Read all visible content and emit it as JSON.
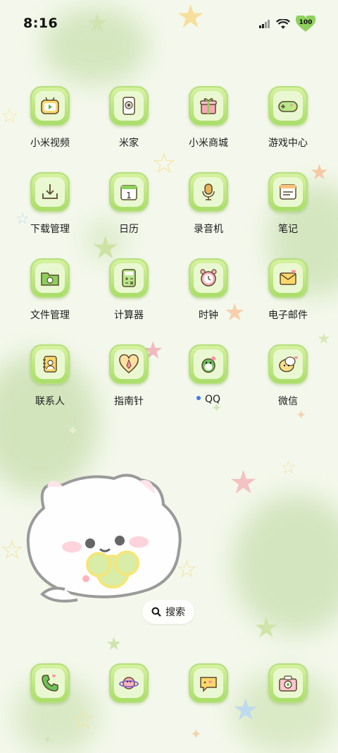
{
  "status_bar": {
    "time": "8:16",
    "battery_level": "100"
  },
  "apps": [
    {
      "label": "小米视频",
      "icon": "tv-icon"
    },
    {
      "label": "米家",
      "icon": "home-device-icon"
    },
    {
      "label": "小米商城",
      "icon": "gift-icon"
    },
    {
      "label": "游戏中心",
      "icon": "gamepad-icon"
    },
    {
      "label": "下载管理",
      "icon": "download-icon"
    },
    {
      "label": "日历",
      "icon": "calendar-icon",
      "calendar_day": "1"
    },
    {
      "label": "录音机",
      "icon": "microphone-icon"
    },
    {
      "label": "笔记",
      "icon": "notes-icon"
    },
    {
      "label": "文件管理",
      "icon": "folder-icon"
    },
    {
      "label": "计算器",
      "icon": "calculator-icon"
    },
    {
      "label": "时钟",
      "icon": "alarm-clock-icon"
    },
    {
      "label": "电子邮件",
      "icon": "envelope-icon"
    },
    {
      "label": "联系人",
      "icon": "contacts-icon"
    },
    {
      "label": "指南针",
      "icon": "compass-icon"
    },
    {
      "label": "QQ",
      "icon": "qq-icon",
      "new_install_dot": true
    },
    {
      "label": "微信",
      "icon": "wechat-icon"
    }
  ],
  "search": {
    "label": "搜索",
    "icon": "search-icon"
  },
  "dock": [
    {
      "icon": "phone-icon"
    },
    {
      "icon": "browser-planet-icon"
    },
    {
      "icon": "messages-icon"
    },
    {
      "icon": "camera-icon"
    }
  ],
  "colors": {
    "icon_green": "#a9dd69",
    "icon_border": "#b5e07c",
    "new_dot": "#3f7cf0"
  }
}
